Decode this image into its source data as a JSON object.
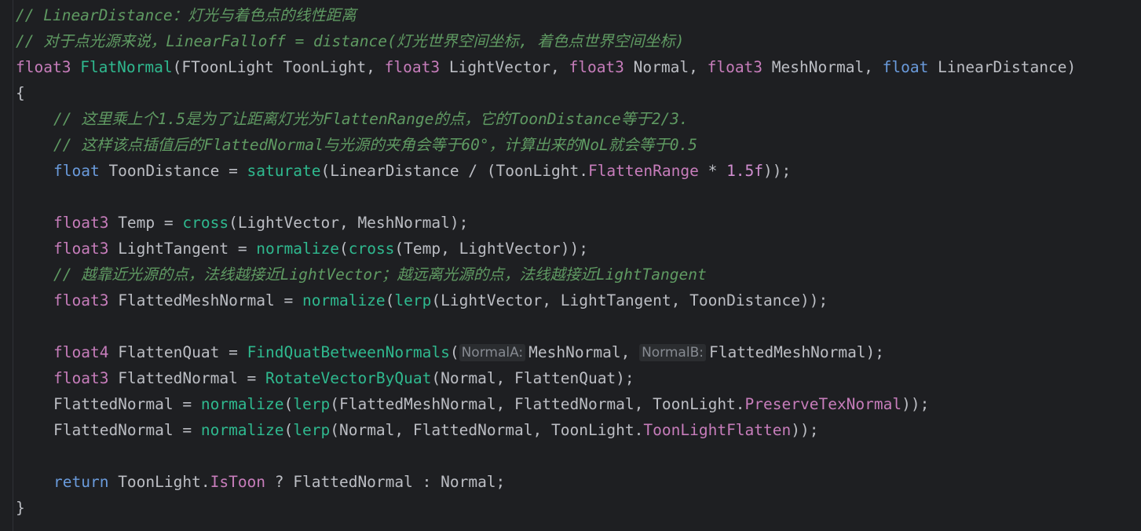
{
  "editor": {
    "language": "hlsl",
    "lines": [
      {
        "indent": 0,
        "tokens": [
          {
            "t": "c",
            "v": "// LinearDistance：灯光与着色点的线性距离"
          }
        ]
      },
      {
        "indent": 0,
        "tokens": [
          {
            "t": "c",
            "v": "// 对于点光源来说，LinearFalloff = distance(灯光世界空间坐标, 着色点世界空间坐标)"
          }
        ]
      },
      {
        "indent": 0,
        "tokens": [
          {
            "t": "k",
            "v": "float3"
          },
          {
            "t": "t",
            "v": " "
          },
          {
            "t": "fc",
            "v": "FlatNormal"
          },
          {
            "t": "t",
            "v": "("
          },
          {
            "t": "t",
            "v": "FToonLight ToonLight, "
          },
          {
            "t": "k",
            "v": "float3"
          },
          {
            "t": "t",
            "v": " LightVector, "
          },
          {
            "t": "k",
            "v": "float3"
          },
          {
            "t": "t",
            "v": " Normal, "
          },
          {
            "t": "k",
            "v": "float3"
          },
          {
            "t": "t",
            "v": " MeshNormal, "
          },
          {
            "t": "kb",
            "v": "float"
          },
          {
            "t": "t",
            "v": " LinearDistance)"
          }
        ]
      },
      {
        "indent": 0,
        "tokens": [
          {
            "t": "t",
            "v": "{"
          }
        ]
      },
      {
        "indent": 1,
        "tokens": [
          {
            "t": "c",
            "v": "// 这里乘上个1.5是为了让距离灯光为FlattenRange的点，它的ToonDistance等于2/3."
          }
        ]
      },
      {
        "indent": 1,
        "tokens": [
          {
            "t": "c",
            "v": "// 这样该点插值后的FlattedNormal与光源的夹角会等于60°，计算出来的NoL就会等于0.5"
          }
        ]
      },
      {
        "indent": 1,
        "tokens": [
          {
            "t": "kb",
            "v": "float"
          },
          {
            "t": "t",
            "v": " ToonDistance = "
          },
          {
            "t": "fc",
            "v": "saturate"
          },
          {
            "t": "t",
            "v": "(LinearDistance / (ToonLight."
          },
          {
            "t": "m",
            "v": "FlattenRange"
          },
          {
            "t": "t",
            "v": " * "
          },
          {
            "t": "n",
            "v": "1.5f"
          },
          {
            "t": "t",
            "v": "));"
          }
        ]
      },
      {
        "indent": 0,
        "tokens": []
      },
      {
        "indent": 1,
        "tokens": [
          {
            "t": "k",
            "v": "float3"
          },
          {
            "t": "t",
            "v": " Temp = "
          },
          {
            "t": "fc",
            "v": "cross"
          },
          {
            "t": "t",
            "v": "(LightVector, MeshNormal);"
          }
        ]
      },
      {
        "indent": 1,
        "tokens": [
          {
            "t": "k",
            "v": "float3"
          },
          {
            "t": "t",
            "v": " LightTangent = "
          },
          {
            "t": "fc",
            "v": "normalize"
          },
          {
            "t": "t",
            "v": "("
          },
          {
            "t": "fc",
            "v": "cross"
          },
          {
            "t": "t",
            "v": "(Temp, LightVector));"
          }
        ]
      },
      {
        "indent": 1,
        "tokens": [
          {
            "t": "c",
            "v": "// 越靠近光源的点，法线越接近LightVector；越远离光源的点，法线越接近LightTangent"
          }
        ]
      },
      {
        "indent": 1,
        "tokens": [
          {
            "t": "k",
            "v": "float3"
          },
          {
            "t": "t",
            "v": " FlattedMeshNormal = "
          },
          {
            "t": "fc",
            "v": "normalize"
          },
          {
            "t": "t",
            "v": "("
          },
          {
            "t": "fc",
            "v": "lerp"
          },
          {
            "t": "t",
            "v": "(LightVector, LightTangent, ToonDistance));"
          }
        ]
      },
      {
        "indent": 0,
        "tokens": []
      },
      {
        "indent": 1,
        "tokens": [
          {
            "t": "k",
            "v": "float4"
          },
          {
            "t": "t",
            "v": " FlattenQuat = "
          },
          {
            "t": "fc",
            "v": "FindQuatBetweenNormals"
          },
          {
            "t": "t",
            "v": "("
          },
          {
            "t": "hint",
            "v": "NormalA:"
          },
          {
            "t": "t",
            "v": "MeshNormal, "
          },
          {
            "t": "hint",
            "v": "NormalB:"
          },
          {
            "t": "t",
            "v": "FlattedMeshNormal);"
          }
        ]
      },
      {
        "indent": 1,
        "tokens": [
          {
            "t": "k",
            "v": "float3"
          },
          {
            "t": "t",
            "v": " FlattedNormal = "
          },
          {
            "t": "fc",
            "v": "RotateVectorByQuat"
          },
          {
            "t": "t",
            "v": "(Normal, FlattenQuat);"
          }
        ]
      },
      {
        "indent": 1,
        "tokens": [
          {
            "t": "t",
            "v": "FlattedNormal = "
          },
          {
            "t": "fc",
            "v": "normalize"
          },
          {
            "t": "t",
            "v": "("
          },
          {
            "t": "fc",
            "v": "lerp"
          },
          {
            "t": "t",
            "v": "(FlattedMeshNormal, FlattedNormal, ToonLight."
          },
          {
            "t": "m",
            "v": "PreserveTexNormal"
          },
          {
            "t": "t",
            "v": "));"
          }
        ]
      },
      {
        "indent": 1,
        "tokens": [
          {
            "t": "t",
            "v": "FlattedNormal = "
          },
          {
            "t": "fc",
            "v": "normalize"
          },
          {
            "t": "t",
            "v": "("
          },
          {
            "t": "fc",
            "v": "lerp"
          },
          {
            "t": "t",
            "v": "(Normal, FlattedNormal, ToonLight."
          },
          {
            "t": "m",
            "v": "ToonLightFlatten"
          },
          {
            "t": "t",
            "v": "));"
          }
        ]
      },
      {
        "indent": 0,
        "tokens": []
      },
      {
        "indent": 1,
        "tokens": [
          {
            "t": "kb",
            "v": "return"
          },
          {
            "t": "t",
            "v": " ToonLight."
          },
          {
            "t": "m",
            "v": "IsToon"
          },
          {
            "t": "t",
            "v": " ? FlattedNormal : Normal;"
          }
        ]
      },
      {
        "indent": 0,
        "tokens": [
          {
            "t": "t",
            "v": "}"
          }
        ]
      }
    ]
  }
}
